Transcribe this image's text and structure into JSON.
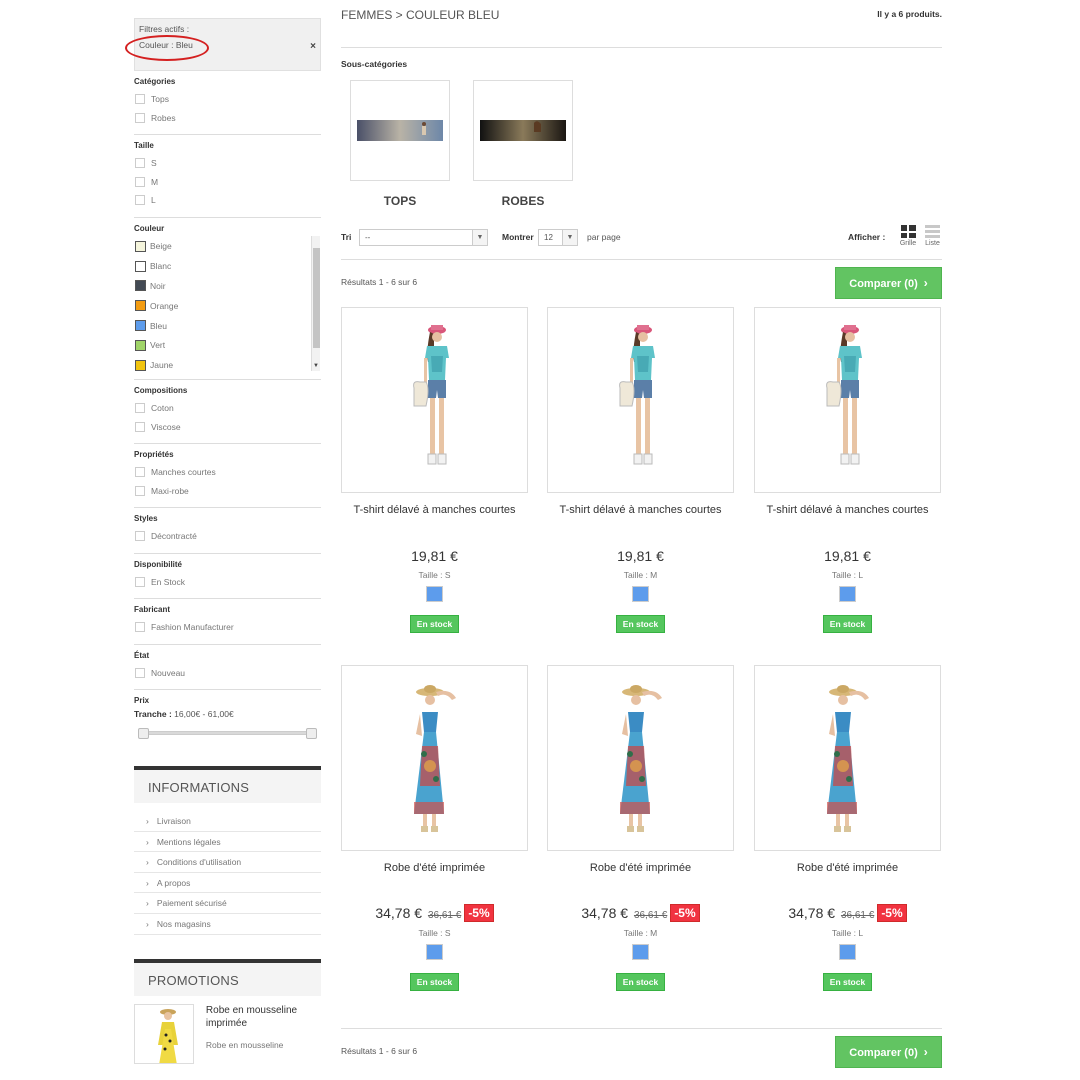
{
  "active_filters": {
    "title": "Filtres actifs :",
    "chip": "Couleur : Bleu",
    "remove": "×"
  },
  "filters": {
    "categories": {
      "title": "Catégories",
      "options": [
        "Tops",
        "Robes"
      ]
    },
    "taille": {
      "title": "Taille",
      "options": [
        "S",
        "M",
        "L"
      ]
    },
    "couleur": {
      "title": "Couleur",
      "options": [
        {
          "label": "Beige",
          "color": "#f5f5dc"
        },
        {
          "label": "Blanc",
          "color": "#ffffff"
        },
        {
          "label": "Noir",
          "color": "#434a54"
        },
        {
          "label": "Orange",
          "color": "#f39c11"
        },
        {
          "label": "Bleu",
          "color": "#5d9cec"
        },
        {
          "label": "Vert",
          "color": "#a0d468"
        },
        {
          "label": "Jaune",
          "color": "#f1c40f"
        }
      ]
    },
    "compositions": {
      "title": "Compositions",
      "options": [
        "Coton",
        "Viscose"
      ]
    },
    "proprietes": {
      "title": "Propriétés",
      "options": [
        "Manches courtes",
        "Maxi-robe"
      ]
    },
    "styles": {
      "title": "Styles",
      "options": [
        "Décontracté"
      ]
    },
    "disponibilite": {
      "title": "Disponibilité",
      "options": [
        "En Stock"
      ]
    },
    "fabricant": {
      "title": "Fabricant",
      "options": [
        "Fashion Manufacturer"
      ]
    },
    "etat": {
      "title": "État",
      "options": [
        "Nouveau"
      ]
    },
    "prix": {
      "title": "Prix",
      "range_label": "Tranche :",
      "range_value": "16,00€ - 61,00€"
    }
  },
  "informations": {
    "title": "Informations",
    "links": [
      "Livraison",
      "Mentions légales",
      "Conditions d'utilisation",
      "A propos",
      "Paiement sécurisé",
      "Nos magasins"
    ]
  },
  "promotions": {
    "title": "Promotions",
    "item_name": "Robe en mousseline imprimée",
    "item_desc": "Robe en mousseline"
  },
  "main": {
    "breadcrumb": "FEMMES > COULEUR BLEU",
    "product_count": "Il y a 6 produits.",
    "subcategories_title": "Sous-catégories",
    "subcategories": [
      "TOPS",
      "ROBES"
    ],
    "sort_label": "Tri",
    "sort_value": "--",
    "show_label": "Montrer",
    "show_value": "12",
    "per_page": "par page",
    "display_label": "Afficher :",
    "view_grid": "Grille",
    "view_list": "Liste",
    "results": "Résultats 1 - 6 sur 6",
    "compare": "Comparer (0)",
    "compare_chevron": "›"
  },
  "products": [
    {
      "name": "T-shirt délavé à manches courtes",
      "price": "19,81 €",
      "size": "Taille : S",
      "stock": "En stock",
      "swatch": "#5d9cec"
    },
    {
      "name": "T-shirt délavé à manches courtes",
      "price": "19,81 €",
      "size": "Taille : M",
      "stock": "En stock",
      "swatch": "#5d9cec"
    },
    {
      "name": "T-shirt délavé à manches courtes",
      "price": "19,81 €",
      "size": "Taille : L",
      "stock": "En stock",
      "swatch": "#5d9cec"
    },
    {
      "name": "Robe d'été imprimée",
      "price": "34,78 €",
      "old_price": "36,61 €",
      "discount": "-5%",
      "size": "Taille : S",
      "stock": "En stock",
      "swatch": "#5d9cec"
    },
    {
      "name": "Robe d'été imprimée",
      "price": "34,78 €",
      "old_price": "36,61 €",
      "discount": "-5%",
      "size": "Taille : M",
      "stock": "En stock",
      "swatch": "#5d9cec"
    },
    {
      "name": "Robe d'été imprimée",
      "price": "34,78 €",
      "old_price": "36,61 €",
      "discount": "-5%",
      "size": "Taille : L",
      "stock": "En stock",
      "swatch": "#5d9cec"
    }
  ]
}
